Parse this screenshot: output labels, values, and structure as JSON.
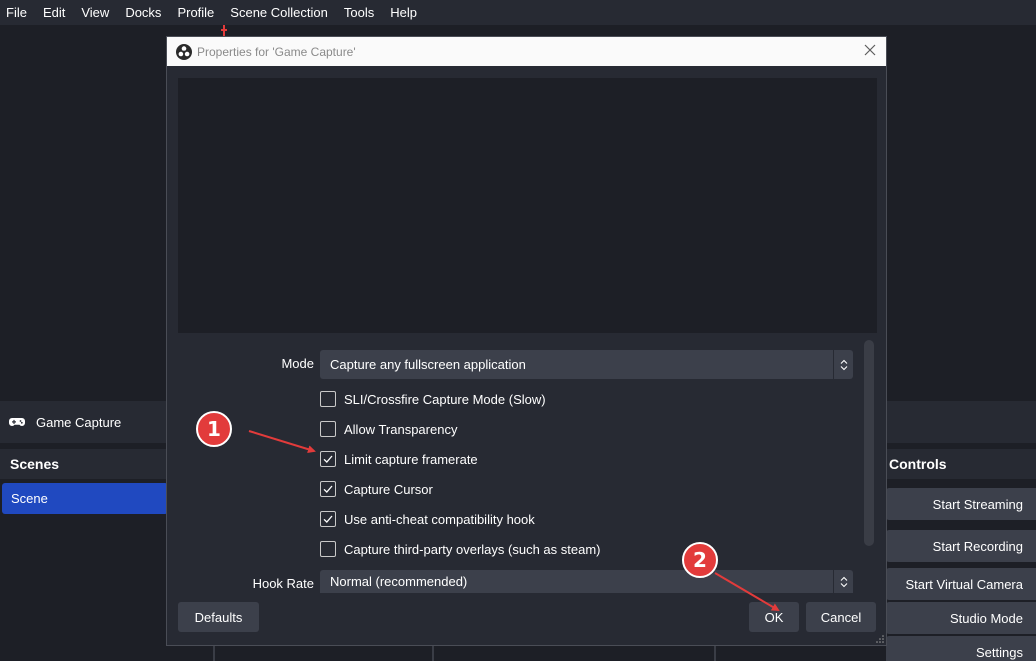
{
  "menubar": {
    "items": [
      "File",
      "Edit",
      "View",
      "Docks",
      "Profile",
      "Scene Collection",
      "Tools",
      "Help"
    ]
  },
  "source_bar": {
    "icon": "gamepad-icon",
    "label": "Game Capture"
  },
  "scenes": {
    "header": "Scenes",
    "items": [
      "Scene"
    ]
  },
  "controls": {
    "header": "Controls",
    "buttons": [
      "Start Streaming",
      "Start Recording",
      "Start Virtual Camera",
      "Studio Mode",
      "Settings"
    ]
  },
  "dialog": {
    "title": "Properties for 'Game Capture'",
    "mode_label": "Mode",
    "mode_value": "Capture any fullscreen application",
    "checkboxes": [
      {
        "label": "SLI/Crossfire Capture Mode (Slow)",
        "checked": false
      },
      {
        "label": "Allow Transparency",
        "checked": false
      },
      {
        "label": "Limit capture framerate",
        "checked": true
      },
      {
        "label": "Capture Cursor",
        "checked": true
      },
      {
        "label": "Use anti-cheat compatibility hook",
        "checked": true
      },
      {
        "label": "Capture third-party overlays (such as steam)",
        "checked": false
      }
    ],
    "hook_rate_label": "Hook Rate",
    "hook_rate_value": "Normal (recommended)",
    "defaults_label": "Defaults",
    "ok_label": "OK",
    "cancel_label": "Cancel"
  },
  "annotations": {
    "badge1": "1",
    "badge2": "2",
    "color": "#e23b3b"
  }
}
